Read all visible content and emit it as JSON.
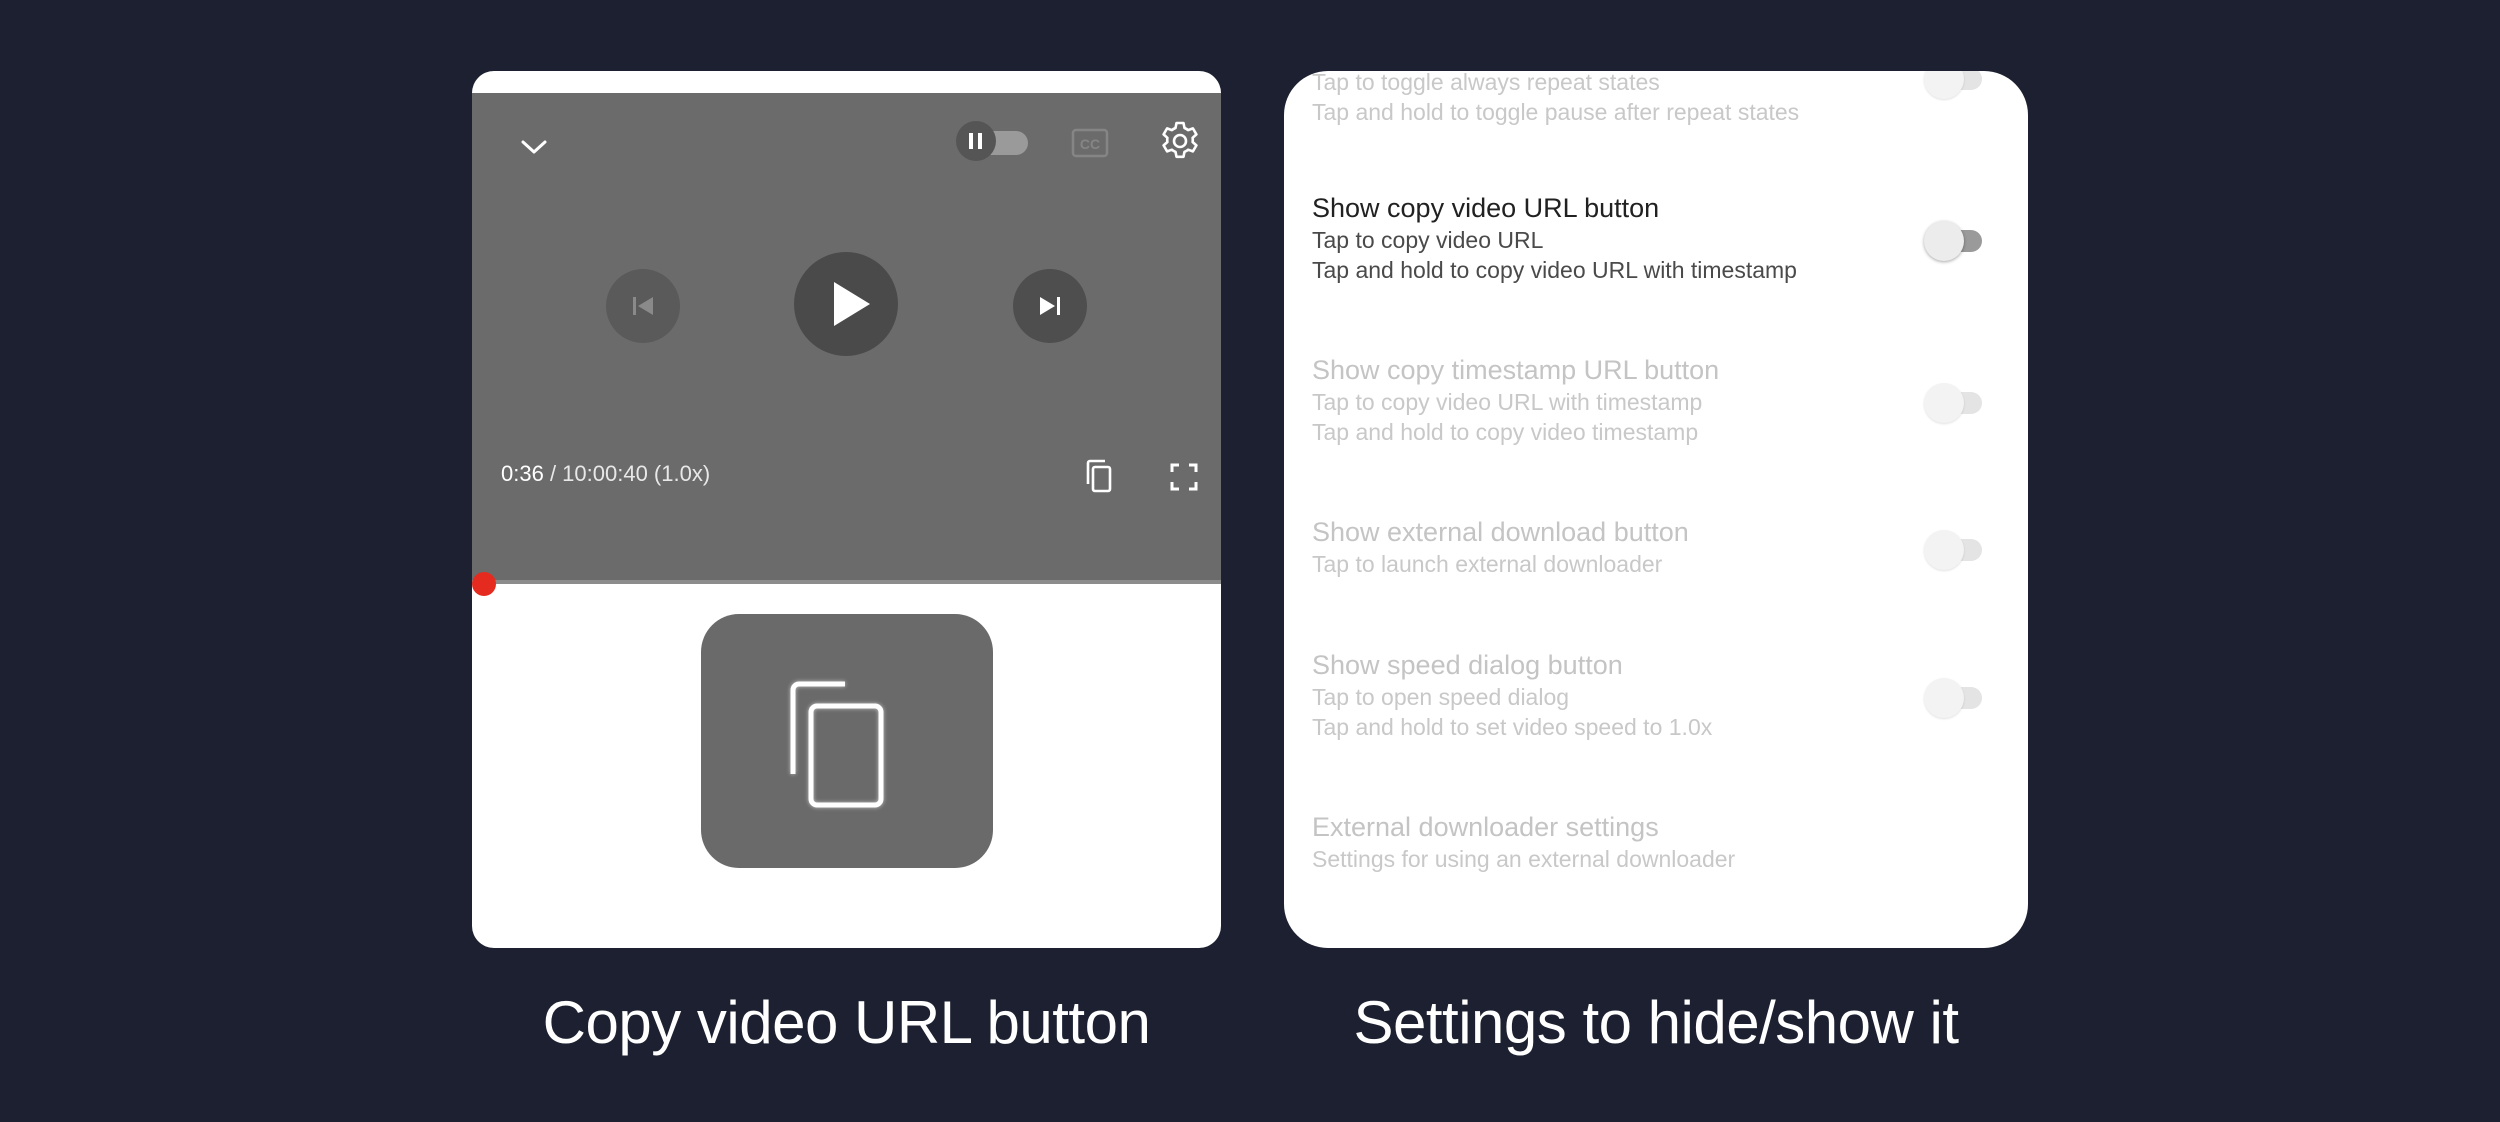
{
  "player": {
    "time_current": "0:36",
    "time_rest": " / 10:00:40 (1.0x)",
    "progress_fraction": 0.0,
    "icons": {
      "collapse": "chevron-down-icon",
      "autoplay": "pause-toggle-icon",
      "captions": "closed-captions-icon",
      "settings": "gear-icon",
      "previous": "skip-previous-icon",
      "play": "play-icon",
      "next": "skip-next-icon",
      "copy_url": "copy-icon",
      "fullscreen": "fullscreen-icon"
    }
  },
  "copy_tile": {
    "icon": "copy-icon"
  },
  "settings": {
    "top_partial": {
      "desc1": "Tap to toggle always repeat states",
      "desc2": "Tap and hold to toggle pause after repeat states"
    },
    "items": [
      {
        "title": "Show copy video URL button",
        "desc1": "Tap to copy video URL",
        "desc2": "Tap and hold to copy video URL with timestamp"
      },
      {
        "title": "Show copy timestamp URL button",
        "desc1": "Tap to copy video URL with timestamp",
        "desc2": "Tap and hold to copy video timestamp"
      },
      {
        "title": "Show external download button",
        "desc1": "Tap to launch external downloader"
      },
      {
        "title": "Show speed dialog button",
        "desc1": "Tap to open speed dialog",
        "desc2": "Tap and hold to set video speed to 1.0x"
      },
      {
        "title": "External downloader settings",
        "desc1": "Settings for using an external downloader"
      }
    ]
  },
  "captions": {
    "left": "Copy video URL button",
    "right": "Settings to hide/show it"
  },
  "colors": {
    "background": "#1c2030",
    "player": "#6b6b6b",
    "progress": "#e52b20",
    "panel": "#ffffff"
  }
}
